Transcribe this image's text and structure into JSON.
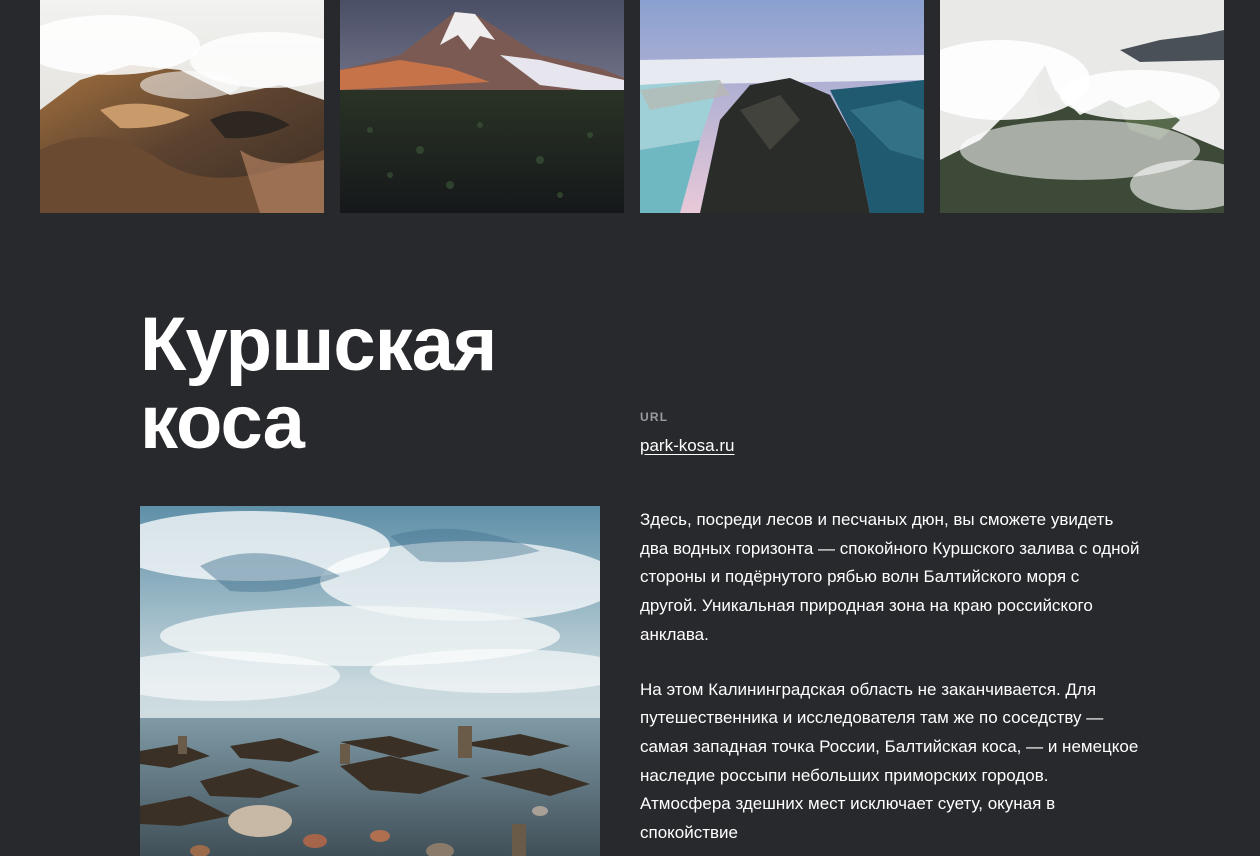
{
  "gallery": {
    "images": [
      {
        "alt": "volcanic-crater-in-mist-photo"
      },
      {
        "alt": "snow-capped-volcano-photo"
      },
      {
        "alt": "coastal-cliff-aerial-photo"
      },
      {
        "alt": "mountain-peak-in-clouds-photo"
      }
    ]
  },
  "place": {
    "title_line1": "Куршская",
    "title_line2": "коса",
    "url_label": "URL",
    "url": "park-kosa.ru",
    "main_photo": "baltic-shore-with-tree-stumps-photo",
    "paragraphs": [
      "Здесь, посреди лесов и песчаных дюн, вы сможете увидеть два водных горизонта — спокойного Куршского залива с одной стороны и подёрнутого рябью волн Балтийского моря с другой. Уникальная природная зона на краю российского анклава.",
      "На этом Калининградская область не заканчивается. Для путешественника и исследователя там же по соседству — самая западная точка России, Балтийская коса, — и немецкое наследие россыпи небольших приморских городов. Атмосфера здешних мест исключает суету, окуная в спокойствие"
    ]
  },
  "colors": {
    "background": "#28292d",
    "text": "#ffffff",
    "label": "#9a9ba0"
  }
}
